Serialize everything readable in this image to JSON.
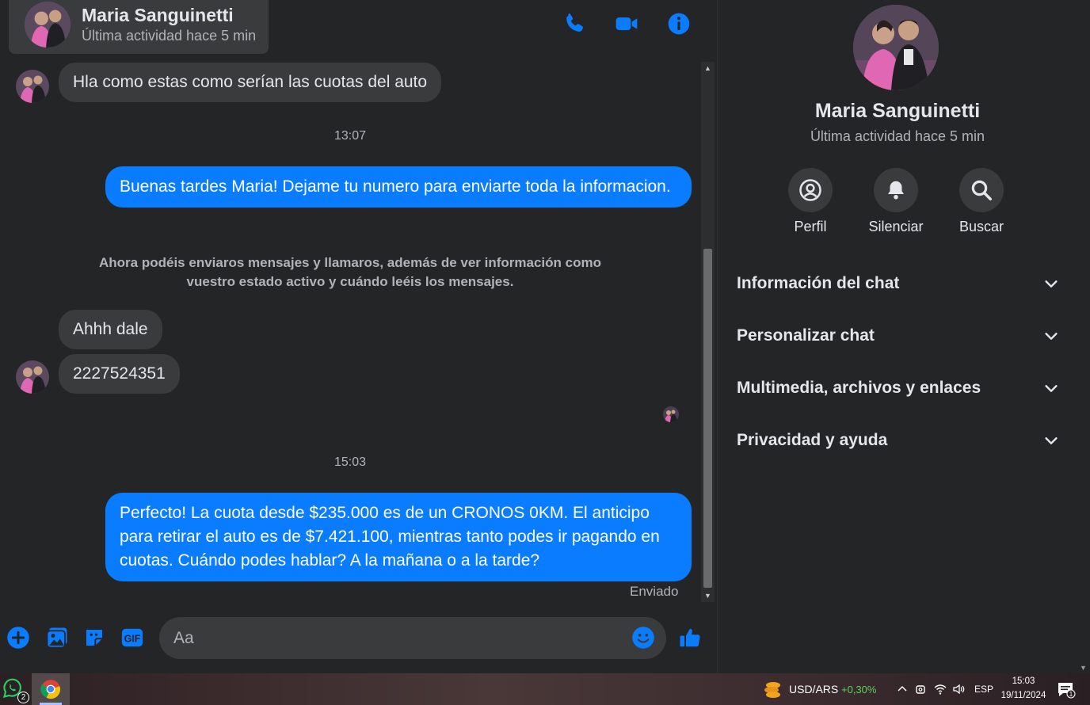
{
  "header": {
    "name": "Maria Sanguinetti",
    "status": "Última actividad hace 5 min"
  },
  "messages": {
    "m1": "Hla como estas como serían las cuotas del auto",
    "t1": "13:07",
    "m2": "Buenas tardes Maria! Dejame tu numero para enviarte toda la informacion.",
    "system_note": "Ahora podéis enviaros mensajes y llamaros, además de ver información como vuestro estado activo y cuándo leéis los mensajes.",
    "m3": "Ahhh dale",
    "m4": "2227524351",
    "t2": "15:03",
    "m5": "Perfecto! La cuota desde $235.000 es de un CRONOS 0KM. El anticipo para retirar el auto es de $7.421.100, mientras tanto podes ir pagando en cuotas. Cuándo podes hablar? A la mañana o a la tarde?",
    "sent_status": "Enviado"
  },
  "composer": {
    "placeholder": "Aa"
  },
  "panel": {
    "name": "Maria Sanguinetti",
    "status": "Última actividad hace 5 min",
    "actions": {
      "profile": "Perfil",
      "mute": "Silenciar",
      "search": "Buscar"
    },
    "sections": [
      "Información del chat",
      "Personalizar chat",
      "Multimedia, archivos y enlaces",
      "Privacidad y ayuda"
    ]
  },
  "taskbar": {
    "whatsapp_badge": "2",
    "currency_pair": "USD/ARS",
    "currency_change": "+0,30%",
    "language": "ESP",
    "time": "15:03",
    "date": "19/11/2024",
    "notification_count": "1"
  },
  "colors": {
    "accent": "#0a7cff",
    "background": "#242526",
    "bubble_in": "#3a3b3c",
    "icon_blue": "#0a7cff",
    "positive_change": "#5ad25a"
  }
}
